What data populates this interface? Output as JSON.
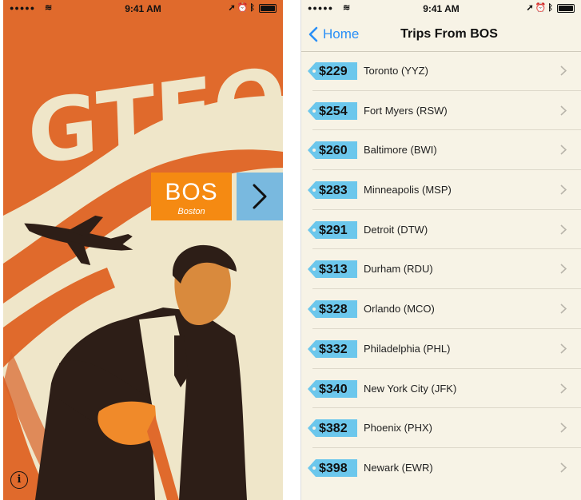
{
  "status_bar": {
    "time": "9:41 AM"
  },
  "splash": {
    "logo_text": "GTFO!",
    "origin_code": "BOS",
    "origin_city": "Boston",
    "info_label": "i"
  },
  "trips_screen": {
    "back_label": "Home",
    "title": "Trips From BOS",
    "trips": [
      {
        "price": "$229",
        "destination": "Toronto (YYZ)"
      },
      {
        "price": "$254",
        "destination": "Fort Myers (RSW)"
      },
      {
        "price": "$260",
        "destination": "Baltimore (BWI)"
      },
      {
        "price": "$283",
        "destination": "Minneapolis (MSP)"
      },
      {
        "price": "$291",
        "destination": "Detroit (DTW)"
      },
      {
        "price": "$313",
        "destination": "Durham (RDU)"
      },
      {
        "price": "$328",
        "destination": "Orlando (MCO)"
      },
      {
        "price": "$332",
        "destination": "Philadelphia (PHL)"
      },
      {
        "price": "$340",
        "destination": "New York City (JFK)"
      },
      {
        "price": "$382",
        "destination": "Phoenix (PHX)"
      },
      {
        "price": "$398",
        "destination": "Newark (EWR)"
      }
    ]
  },
  "colors": {
    "poster_orange": "#e06a2c",
    "poster_cream": "#efe6c9",
    "origin_button": "#f58a12",
    "next_button": "#79b9df",
    "price_tag": "#6cc7ec",
    "ios_blue": "#2a8ff7"
  },
  "icons": [
    "signal-dots-icon",
    "wifi-icon",
    "location-icon",
    "alarm-icon",
    "bluetooth-icon",
    "battery-icon",
    "airplane-illustration",
    "chevron-right-icon",
    "info-icon",
    "back-chevron-icon",
    "price-tag-icon"
  ]
}
